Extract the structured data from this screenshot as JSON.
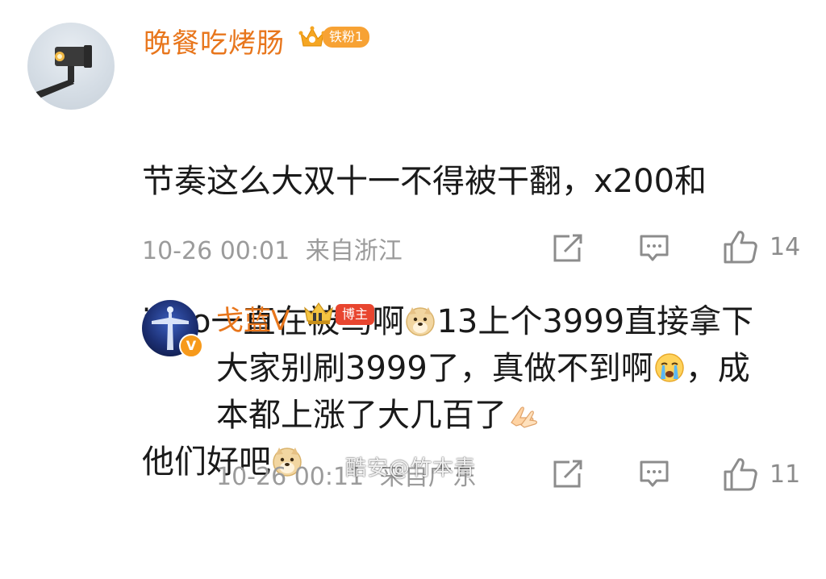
{
  "comment": {
    "username": "晚餐吃烤肠",
    "fan_badge": "铁粉1",
    "text_lines": [
      "节奏这么大双十一不得被干翻，x200和",
      "iqoo一直在被骂啊",
      "13上个3999直接拿下",
      "他们好吧"
    ],
    "timestamp": "10-26 00:01",
    "location": "来自浙江",
    "like_count": "14"
  },
  "reply": {
    "username": "戈蓝V",
    "role_badge": "博主",
    "verified_mark": "V",
    "text_lines": [
      "大家别刷3999了，真做不到啊",
      "，成",
      "本都上涨了大几百了"
    ],
    "timestamp": "10-26 00:11",
    "location": "来自广东",
    "like_count": "11"
  },
  "watermark": "酷安@竹本青",
  "icons": {
    "repost": "share-edit-icon",
    "comment": "comment-bubble-icon",
    "like": "thumbs-up-icon",
    "doge": "doge-emoji-icon",
    "cry": "crying-emoji-icon",
    "pray": "pray-hands-emoji-icon"
  },
  "colors": {
    "username": "#e8761c",
    "fan_badge_bg": "#f7a234",
    "host_badge_bg": "#e8452f",
    "meta_text": "#9b9b9b"
  }
}
